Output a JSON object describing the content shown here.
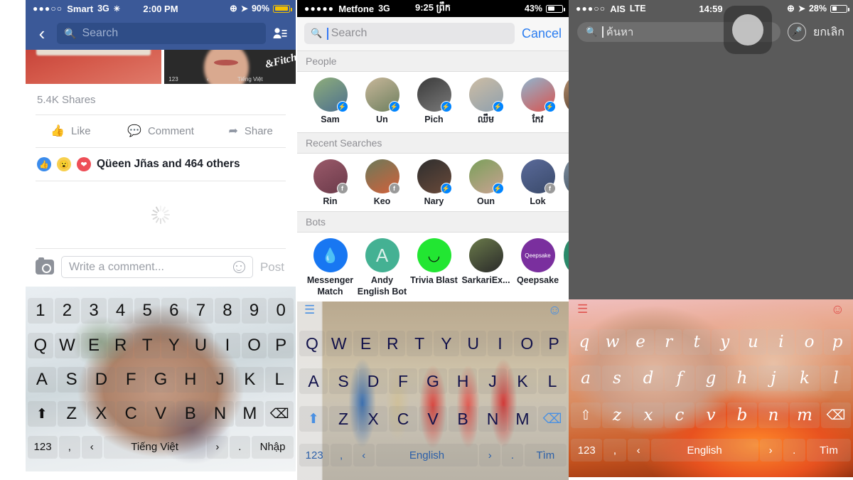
{
  "panels": {
    "facebook": {
      "status": {
        "dots": "●●●○○",
        "carrier": "Smart",
        "network": "3G",
        "activity_icon": "loading-spinner-icon",
        "time": "2:00 PM",
        "lock_icon": "rotation-lock-icon",
        "location_icon": "location-arrow-icon",
        "battery_pct": "90%",
        "battery_icon": "battery-low-power-icon"
      },
      "nav": {
        "back_icon": "chevron-left-icon",
        "search_icon": "search-icon",
        "search_placeholder": "Search",
        "friends_icon": "friend-requests-icon"
      },
      "post": {
        "shares": "5.4K Shares",
        "actions": [
          {
            "label": "Like",
            "icon": "thumbs-up-icon"
          },
          {
            "label": "Comment",
            "icon": "comment-bubble-icon"
          },
          {
            "label": "Share",
            "icon": "share-arrow-icon"
          }
        ],
        "reactions_text": "Qüeen Jñas and 464 others",
        "reaction_icons": [
          "like-reaction-icon",
          "wow-reaction-icon",
          "love-reaction-icon"
        ],
        "loading_icon": "loading-spinner-icon"
      },
      "comment_bar": {
        "camera_icon": "camera-icon",
        "placeholder": "Write a comment...",
        "emoji_icon": "smiley-face-icon",
        "post_label": "Post"
      },
      "keyboard": {
        "rows": [
          [
            "1",
            "2",
            "3",
            "4",
            "5",
            "6",
            "7",
            "8",
            "9",
            "0"
          ],
          [
            "Q",
            "W",
            "E",
            "R",
            "T",
            "Y",
            "U",
            "I",
            "O",
            "P"
          ],
          [
            "A",
            "S",
            "D",
            "F",
            "G",
            "H",
            "J",
            "K",
            "L"
          ],
          [
            "⬆",
            "Z",
            "X",
            "C",
            "V",
            "B",
            "N",
            "M",
            "⌫"
          ]
        ],
        "bottom": {
          "numbers_label": "123",
          "comma_label": ",",
          "prev_label": "‹",
          "space_label": "Tiếng Việt",
          "next_label": "›",
          "period_label": ".",
          "return_label": "Nhập"
        }
      }
    },
    "search": {
      "status": {
        "dots": "●●●●●",
        "carrier": "Metfone",
        "network": "3G",
        "time": "9:25 ព្រឹក",
        "battery_pct": "43%",
        "battery_icon": "battery-icon"
      },
      "searchbar": {
        "search_icon": "search-icon",
        "placeholder": "Search",
        "cancel_label": "Cancel"
      },
      "sections": [
        {
          "title": "People",
          "items": [
            {
              "name": "Sam",
              "badge": "messenger-badge-icon"
            },
            {
              "name": "Un",
              "badge": "messenger-badge-icon"
            },
            {
              "name": "Pich",
              "badge": "messenger-badge-icon"
            },
            {
              "name": "ឈឹម",
              "badge": "messenger-badge-icon"
            },
            {
              "name": "កែវ",
              "badge": "messenger-badge-icon"
            }
          ]
        },
        {
          "title": "Recent Searches",
          "items": [
            {
              "name": "Rin",
              "badge": "facebook-badge-icon"
            },
            {
              "name": "Keo",
              "badge": "facebook-badge-icon"
            },
            {
              "name": "Nary",
              "badge": "messenger-badge-icon"
            },
            {
              "name": "Oun",
              "badge": "messenger-badge-icon"
            },
            {
              "name": "Lok",
              "badge": "facebook-badge-icon"
            }
          ]
        },
        {
          "title": "Bots",
          "items": [
            {
              "name": "Messenger",
              "name2": "Match",
              "badge": ""
            },
            {
              "name": "Andy",
              "name2": "English Bot",
              "badge": ""
            },
            {
              "name": "Trivia Blast",
              "name2": "",
              "badge": ""
            },
            {
              "name": "SarkariEx...",
              "name2": "",
              "badge": ""
            },
            {
              "name": "Qeepsake",
              "name2": "",
              "badge": ""
            }
          ]
        }
      ],
      "keyboard": {
        "hamburger_icon": "keyboard-menu-icon",
        "smiley_icon": "smiley-face-icon",
        "rows": [
          [
            "Q",
            "W",
            "E",
            "R",
            "T",
            "Y",
            "U",
            "I",
            "O",
            "P"
          ],
          [
            "A",
            "S",
            "D",
            "F",
            "G",
            "H",
            "J",
            "K",
            "L"
          ],
          [
            "⬆",
            "Z",
            "X",
            "C",
            "V",
            "B",
            "N",
            "M",
            "⌫"
          ]
        ],
        "bottom": {
          "numbers_label": "123",
          "comma_label": ",",
          "prev_label": "‹",
          "space_label": "English",
          "next_label": "›",
          "period_label": ".",
          "return_label": "Tìm"
        }
      }
    },
    "thai": {
      "status": {
        "dots": "●●●○○",
        "carrier": "AIS",
        "network": "LTE",
        "time": "14:59",
        "lock_icon": "rotation-lock-icon",
        "location_icon": "location-arrow-icon",
        "battery_pct": "28%",
        "battery_icon": "battery-icon"
      },
      "searchbar": {
        "search_icon": "search-icon",
        "placeholder": "ค้นหา",
        "mic_icon": "microphone-icon",
        "cancel_label": "ยกเลิก"
      },
      "keyboard": {
        "hamburger_icon": "keyboard-menu-icon",
        "smiley_icon": "smiley-face-icon",
        "rows": [
          [
            "q",
            "w",
            "e",
            "r",
            "t",
            "y",
            "u",
            "i",
            "o",
            "p"
          ],
          [
            "a",
            "s",
            "d",
            "f",
            "g",
            "h",
            "j",
            "k",
            "l"
          ],
          [
            "⇧",
            "z",
            "x",
            "c",
            "v",
            "b",
            "n",
            "m",
            "⌫"
          ]
        ],
        "bottom": {
          "numbers_label": "123",
          "comma_label": ",",
          "prev_label": "‹",
          "space_label": "English",
          "next_label": "›",
          "period_label": ".",
          "return_label": "Tìm"
        }
      }
    }
  },
  "colors": {
    "facebook_blue": "#3b5998",
    "ios_blue": "#007aff",
    "battery_yellow": "#f3c100",
    "messenger_blue": "#0084ff",
    "thai_gray": "#5a5a5a"
  }
}
